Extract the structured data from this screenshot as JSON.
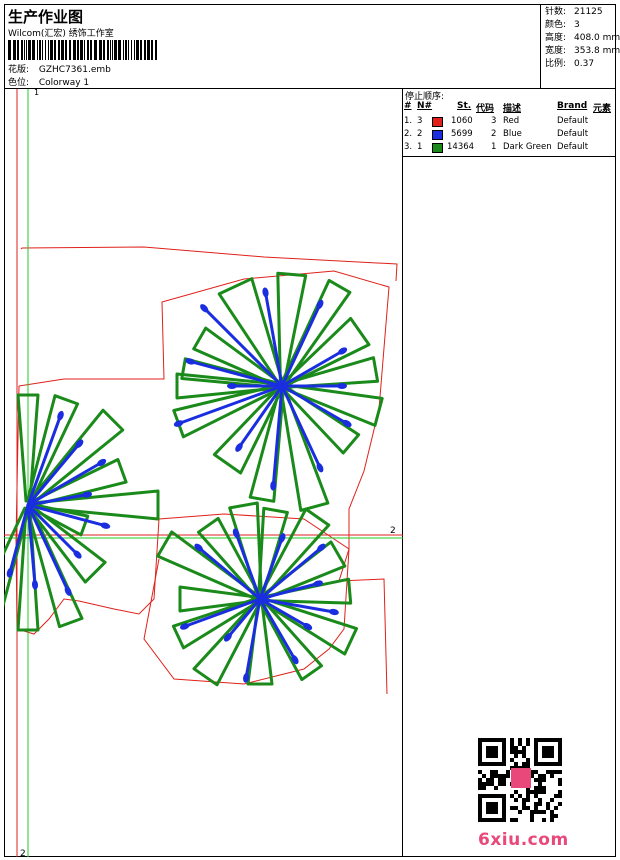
{
  "header": {
    "title": "生产作业图",
    "company": "Wilcom(汇宏) 绣饰工作室",
    "design_label": "花版:",
    "design_value": "GZHC7361.emb",
    "colorway_label": "色位:",
    "colorway_value": "Colorway 1"
  },
  "stats": [
    {
      "label": "针数:",
      "value": "21125"
    },
    {
      "label": "颜色:",
      "value": "3"
    },
    {
      "label": "高度:",
      "value": "408.0 mm"
    },
    {
      "label": "宽度:",
      "value": "353.8 mm"
    },
    {
      "label": "比例:",
      "value": "0.37"
    }
  ],
  "stop_sequence": {
    "title": "停止顺序:",
    "headers": {
      "num": "#",
      "n": "N#",
      "st": "St.",
      "code": "代码",
      "desc": "描述",
      "brand": "Brand",
      "element": "元素"
    },
    "rows": [
      {
        "num": "1.",
        "n": "3",
        "color": "#e0201a",
        "st": "1060",
        "code": "3",
        "desc": "Red",
        "brand": "Default"
      },
      {
        "num": "2.",
        "n": "2",
        "color": "#1a2ee0",
        "st": "5699",
        "code": "2",
        "desc": "Blue",
        "brand": "Default"
      },
      {
        "num": "3.",
        "n": "1",
        "color": "#1a8a1a",
        "st": "14364",
        "code": "1",
        "desc": "Dark Green",
        "brand": "Default"
      }
    ]
  },
  "canvas_markers": {
    "marker_1": "1",
    "marker_2_right": "2",
    "marker_2_bottom": "2"
  },
  "colors": {
    "red": "#e0201a",
    "blue": "#1a2ee0",
    "green": "#1a8a1a",
    "guide_green": "#22cc22",
    "guide_red": "#dd2222"
  },
  "watermark": "6xiu.com"
}
